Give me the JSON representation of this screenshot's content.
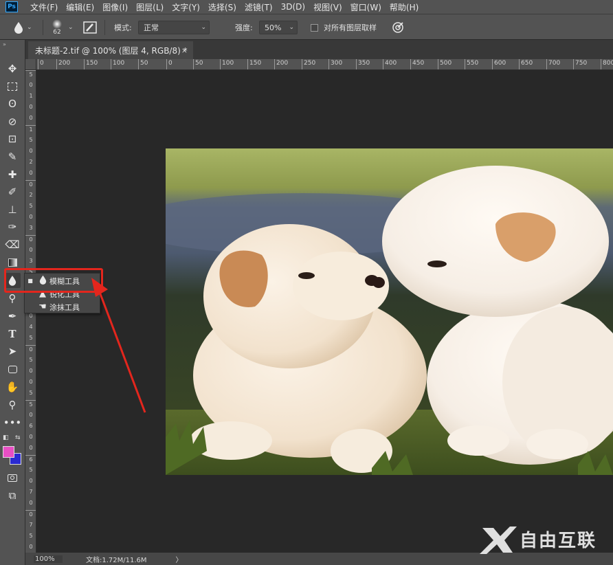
{
  "app": {
    "logo": "Ps"
  },
  "menu": [
    "文件(F)",
    "编辑(E)",
    "图像(I)",
    "图层(L)",
    "文字(Y)",
    "选择(S)",
    "滤镜(T)",
    "3D(D)",
    "视图(V)",
    "窗口(W)",
    "帮助(H)"
  ],
  "options": {
    "brush_size": "62",
    "mode_label": "模式:",
    "mode_value": "正常",
    "strength_label": "强度:",
    "strength_value": "50%",
    "sample_all_label": "对所有图层取样"
  },
  "tab": {
    "title": "未标题-2.tif @ 100% (图层 4, RGB/8) *",
    "close": "×"
  },
  "ruler_h": [
    "0",
    "200",
    "150",
    "100",
    "50",
    "0",
    "50",
    "100",
    "150",
    "200",
    "250",
    "300",
    "350",
    "400",
    "450",
    "500",
    "550",
    "600",
    "650",
    "700",
    "750",
    "800"
  ],
  "ruler_v": [
    "5",
    "0",
    "1",
    "0",
    "0",
    "1",
    "5",
    "0",
    "2",
    "0",
    "0",
    "2",
    "5",
    "0",
    "3",
    "0",
    "0",
    "3",
    "5",
    "0",
    "4",
    "0",
    "0",
    "4",
    "5",
    "0",
    "5",
    "0",
    "0",
    "5",
    "5",
    "0",
    "6",
    "0",
    "0",
    "6",
    "5",
    "0",
    "7",
    "0",
    "0",
    "7",
    "5",
    "0"
  ],
  "flyout": [
    {
      "label": "模糊工具",
      "icon": "blur-icon"
    },
    {
      "label": "锐化工具",
      "icon": "sharpen-icon"
    },
    {
      "label": "涂抹工具",
      "icon": "smudge-icon"
    }
  ],
  "status": {
    "zoom": "100%",
    "doc": "文档:1.72M/11.6M",
    "arrow": "〉"
  },
  "colors": {
    "foreground": "#e84fc4",
    "background": "#2a2ad0",
    "highlight": "#e3261d"
  },
  "watermark": {
    "text": "自由互联"
  }
}
